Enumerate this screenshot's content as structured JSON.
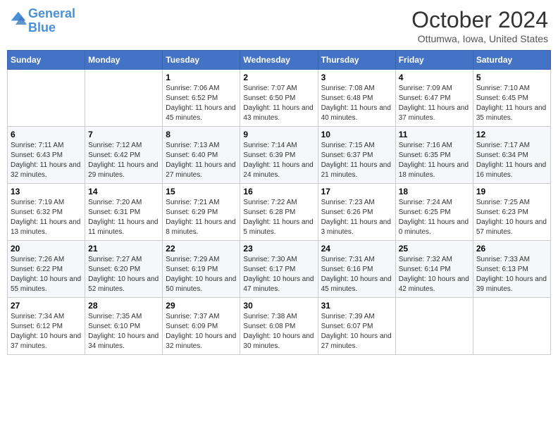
{
  "header": {
    "logo_line1": "General",
    "logo_line2": "Blue",
    "month": "October 2024",
    "location": "Ottumwa, Iowa, United States"
  },
  "weekdays": [
    "Sunday",
    "Monday",
    "Tuesday",
    "Wednesday",
    "Thursday",
    "Friday",
    "Saturday"
  ],
  "weeks": [
    [
      {
        "day": "",
        "sunrise": "",
        "sunset": "",
        "daylight": ""
      },
      {
        "day": "",
        "sunrise": "",
        "sunset": "",
        "daylight": ""
      },
      {
        "day": "1",
        "sunrise": "Sunrise: 7:06 AM",
        "sunset": "Sunset: 6:52 PM",
        "daylight": "Daylight: 11 hours and 45 minutes."
      },
      {
        "day": "2",
        "sunrise": "Sunrise: 7:07 AM",
        "sunset": "Sunset: 6:50 PM",
        "daylight": "Daylight: 11 hours and 43 minutes."
      },
      {
        "day": "3",
        "sunrise": "Sunrise: 7:08 AM",
        "sunset": "Sunset: 6:48 PM",
        "daylight": "Daylight: 11 hours and 40 minutes."
      },
      {
        "day": "4",
        "sunrise": "Sunrise: 7:09 AM",
        "sunset": "Sunset: 6:47 PM",
        "daylight": "Daylight: 11 hours and 37 minutes."
      },
      {
        "day": "5",
        "sunrise": "Sunrise: 7:10 AM",
        "sunset": "Sunset: 6:45 PM",
        "daylight": "Daylight: 11 hours and 35 minutes."
      }
    ],
    [
      {
        "day": "6",
        "sunrise": "Sunrise: 7:11 AM",
        "sunset": "Sunset: 6:43 PM",
        "daylight": "Daylight: 11 hours and 32 minutes."
      },
      {
        "day": "7",
        "sunrise": "Sunrise: 7:12 AM",
        "sunset": "Sunset: 6:42 PM",
        "daylight": "Daylight: 11 hours and 29 minutes."
      },
      {
        "day": "8",
        "sunrise": "Sunrise: 7:13 AM",
        "sunset": "Sunset: 6:40 PM",
        "daylight": "Daylight: 11 hours and 27 minutes."
      },
      {
        "day": "9",
        "sunrise": "Sunrise: 7:14 AM",
        "sunset": "Sunset: 6:39 PM",
        "daylight": "Daylight: 11 hours and 24 minutes."
      },
      {
        "day": "10",
        "sunrise": "Sunrise: 7:15 AM",
        "sunset": "Sunset: 6:37 PM",
        "daylight": "Daylight: 11 hours and 21 minutes."
      },
      {
        "day": "11",
        "sunrise": "Sunrise: 7:16 AM",
        "sunset": "Sunset: 6:35 PM",
        "daylight": "Daylight: 11 hours and 18 minutes."
      },
      {
        "day": "12",
        "sunrise": "Sunrise: 7:17 AM",
        "sunset": "Sunset: 6:34 PM",
        "daylight": "Daylight: 11 hours and 16 minutes."
      }
    ],
    [
      {
        "day": "13",
        "sunrise": "Sunrise: 7:19 AM",
        "sunset": "Sunset: 6:32 PM",
        "daylight": "Daylight: 11 hours and 13 minutes."
      },
      {
        "day": "14",
        "sunrise": "Sunrise: 7:20 AM",
        "sunset": "Sunset: 6:31 PM",
        "daylight": "Daylight: 11 hours and 11 minutes."
      },
      {
        "day": "15",
        "sunrise": "Sunrise: 7:21 AM",
        "sunset": "Sunset: 6:29 PM",
        "daylight": "Daylight: 11 hours and 8 minutes."
      },
      {
        "day": "16",
        "sunrise": "Sunrise: 7:22 AM",
        "sunset": "Sunset: 6:28 PM",
        "daylight": "Daylight: 11 hours and 5 minutes."
      },
      {
        "day": "17",
        "sunrise": "Sunrise: 7:23 AM",
        "sunset": "Sunset: 6:26 PM",
        "daylight": "Daylight: 11 hours and 3 minutes."
      },
      {
        "day": "18",
        "sunrise": "Sunrise: 7:24 AM",
        "sunset": "Sunset: 6:25 PM",
        "daylight": "Daylight: 11 hours and 0 minutes."
      },
      {
        "day": "19",
        "sunrise": "Sunrise: 7:25 AM",
        "sunset": "Sunset: 6:23 PM",
        "daylight": "Daylight: 10 hours and 57 minutes."
      }
    ],
    [
      {
        "day": "20",
        "sunrise": "Sunrise: 7:26 AM",
        "sunset": "Sunset: 6:22 PM",
        "daylight": "Daylight: 10 hours and 55 minutes."
      },
      {
        "day": "21",
        "sunrise": "Sunrise: 7:27 AM",
        "sunset": "Sunset: 6:20 PM",
        "daylight": "Daylight: 10 hours and 52 minutes."
      },
      {
        "day": "22",
        "sunrise": "Sunrise: 7:29 AM",
        "sunset": "Sunset: 6:19 PM",
        "daylight": "Daylight: 10 hours and 50 minutes."
      },
      {
        "day": "23",
        "sunrise": "Sunrise: 7:30 AM",
        "sunset": "Sunset: 6:17 PM",
        "daylight": "Daylight: 10 hours and 47 minutes."
      },
      {
        "day": "24",
        "sunrise": "Sunrise: 7:31 AM",
        "sunset": "Sunset: 6:16 PM",
        "daylight": "Daylight: 10 hours and 45 minutes."
      },
      {
        "day": "25",
        "sunrise": "Sunrise: 7:32 AM",
        "sunset": "Sunset: 6:14 PM",
        "daylight": "Daylight: 10 hours and 42 minutes."
      },
      {
        "day": "26",
        "sunrise": "Sunrise: 7:33 AM",
        "sunset": "Sunset: 6:13 PM",
        "daylight": "Daylight: 10 hours and 39 minutes."
      }
    ],
    [
      {
        "day": "27",
        "sunrise": "Sunrise: 7:34 AM",
        "sunset": "Sunset: 6:12 PM",
        "daylight": "Daylight: 10 hours and 37 minutes."
      },
      {
        "day": "28",
        "sunrise": "Sunrise: 7:35 AM",
        "sunset": "Sunset: 6:10 PM",
        "daylight": "Daylight: 10 hours and 34 minutes."
      },
      {
        "day": "29",
        "sunrise": "Sunrise: 7:37 AM",
        "sunset": "Sunset: 6:09 PM",
        "daylight": "Daylight: 10 hours and 32 minutes."
      },
      {
        "day": "30",
        "sunrise": "Sunrise: 7:38 AM",
        "sunset": "Sunset: 6:08 PM",
        "daylight": "Daylight: 10 hours and 30 minutes."
      },
      {
        "day": "31",
        "sunrise": "Sunrise: 7:39 AM",
        "sunset": "Sunset: 6:07 PM",
        "daylight": "Daylight: 10 hours and 27 minutes."
      },
      {
        "day": "",
        "sunrise": "",
        "sunset": "",
        "daylight": ""
      },
      {
        "day": "",
        "sunrise": "",
        "sunset": "",
        "daylight": ""
      }
    ]
  ]
}
